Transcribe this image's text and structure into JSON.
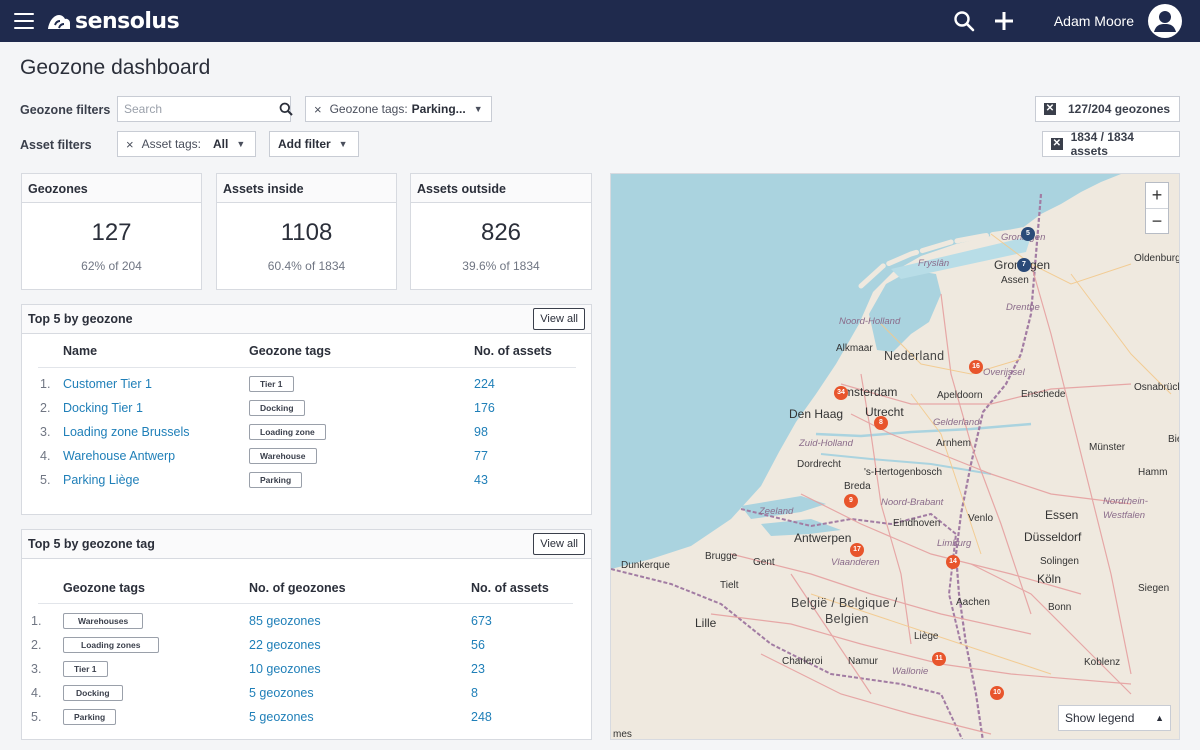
{
  "header": {
    "app_name": "sensolus",
    "user_name": "Adam Moore"
  },
  "page": {
    "title": "Geozone dashboard"
  },
  "filters": {
    "geozone_label": "Geozone filters",
    "search_placeholder": "Search",
    "geozone_tags_label": "Geozone tags:",
    "geozone_tags_value": "Parking...",
    "asset_label": "Asset filters",
    "asset_tags_label": "Asset tags:",
    "asset_tags_value": "All",
    "add_filter": "Add filter",
    "geozone_count": "127/204 geozones",
    "asset_count": "1834 / 1834 assets"
  },
  "stats": [
    {
      "title": "Geozones",
      "value": "127",
      "sub": "62% of 204"
    },
    {
      "title": "Assets inside",
      "value": "1108",
      "sub": "60.4% of 1834"
    },
    {
      "title": "Assets outside",
      "value": "826",
      "sub": "39.6% of 1834"
    }
  ],
  "top_geozone": {
    "title": "Top 5 by geozone",
    "view_all": "View all",
    "columns": [
      "Name",
      "Geozone tags",
      "No. of assets"
    ],
    "rows": [
      {
        "idx": "1.",
        "name": "Customer Tier 1",
        "tag": "Tier 1",
        "assets": "224"
      },
      {
        "idx": "2.",
        "name": "Docking Tier 1",
        "tag": "Docking",
        "assets": "176"
      },
      {
        "idx": "3.",
        "name": "Loading zone Brussels",
        "tag": "Loading zone",
        "assets": "98"
      },
      {
        "idx": "4.",
        "name": "Warehouse Antwerp",
        "tag": "Warehouse",
        "assets": "77"
      },
      {
        "idx": "5.",
        "name": "Parking Liège",
        "tag": "Parking",
        "assets": "43"
      }
    ]
  },
  "top_tag": {
    "title": "Top 5 by geozone tag",
    "view_all": "View all",
    "columns": [
      "Geozone tags",
      "No. of  geozones",
      "No. of assets"
    ],
    "rows": [
      {
        "idx": "1.",
        "tag": "Warehouses",
        "geozones": "85 geozones",
        "assets": "673"
      },
      {
        "idx": "2.",
        "tag": "Loading zones",
        "geozones": "22 geozones",
        "assets": "56"
      },
      {
        "idx": "3.",
        "tag": "Tier 1",
        "geozones": "10 geozones",
        "assets": "23"
      },
      {
        "idx": "4.",
        "tag": "Docking",
        "geozones": "5 geozones",
        "assets": "8"
      },
      {
        "idx": "5.",
        "tag": "Parking",
        "geozones": "5 geozones",
        "assets": "248"
      }
    ]
  },
  "map": {
    "legend_button": "Show legend",
    "zoom_in": "+",
    "zoom_out": "−",
    "colors": {
      "sea": "#aad3df",
      "land": "#efe9df",
      "marker": "#e8552c",
      "cluster": "#2a4a78"
    },
    "labels": {
      "groningen_small": "Groningen",
      "groningen": "Groningen",
      "assen": "Assen",
      "oldenburg": "Oldenburg",
      "fryslan": "Fryslân",
      "drenthe": "Drenthe",
      "noord_holland": "Noord-Holland",
      "alkmaar": "Alkmaar",
      "nederland": "Nederland",
      "overijssel": "Overijssel",
      "osnabruck": "Osnabrück",
      "amsterdam": "Amsterdam",
      "apeldoorn": "Apeldoorn",
      "enschede": "Enschede",
      "den_haag": "Den Haag",
      "utrecht": "Utrecht",
      "zuid_holland": "Zuid-Holland",
      "gelderland": "Gelderland",
      "bie": "Bie",
      "arnhem": "Arnhem",
      "dordrecht": "Dordrecht",
      "munster": "Münster",
      "hertogenbosch": "'s-Hertogenbosch",
      "hamm": "Hamm",
      "breda": "Breda",
      "noord_brabant": "Noord-Brabant",
      "zeeland": "Zeeland",
      "nordrhein": "Nordrhein-",
      "westfalen": "Westfalen",
      "eindhoven": "Eindhoven",
      "venlo": "Venlo",
      "essen": "Essen",
      "antwerpen": "Antwerpen",
      "dusseldorf": "Düsseldorf",
      "dunkerque": "Dunkerque",
      "brugge": "Brugge",
      "gent": "Gent",
      "vlaanderen": "Vlaanderen",
      "limburg": "Limburg",
      "solingen": "Solingen",
      "tielt": "Tielt",
      "koln": "Köln",
      "siegen": "Siegen",
      "belgie": "België / Belgique /",
      "belgien": "Belgien",
      "aachen": "Aachen",
      "bonn": "Bonn",
      "lille": "Lille",
      "liege": "Liège",
      "charleroi": "Charleroi",
      "namur": "Namur",
      "koblenz": "Koblenz",
      "wallonie": "Wallonie",
      "mes": "mes"
    },
    "markers": [
      {
        "count": "5",
        "kind": "cluster"
      },
      {
        "count": "7",
        "kind": "cluster"
      },
      {
        "count": "16",
        "kind": "marker"
      },
      {
        "count": "34",
        "kind": "marker"
      },
      {
        "count": "8",
        "kind": "marker"
      },
      {
        "count": "9",
        "kind": "marker"
      },
      {
        "count": "17",
        "kind": "marker"
      },
      {
        "count": "14",
        "kind": "marker"
      },
      {
        "count": "11",
        "kind": "marker"
      },
      {
        "count": "10",
        "kind": "marker"
      }
    ]
  }
}
